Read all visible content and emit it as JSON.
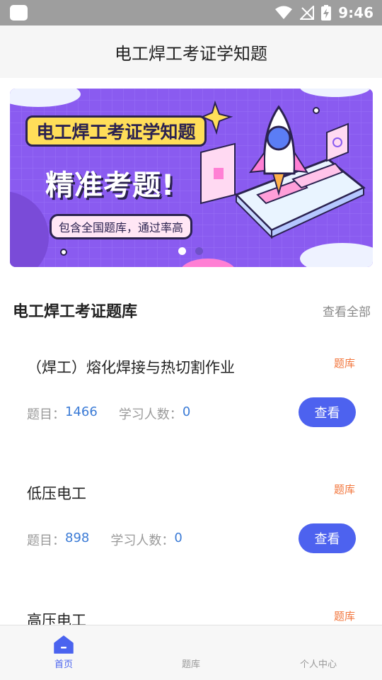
{
  "status_bar": {
    "time": "9:46"
  },
  "app_bar": {
    "title": "电工焊工考证学知题"
  },
  "banner": {
    "title": "电工焊工考证学知题",
    "headline": "精准考题!",
    "chip": "包含全国题库，通过率高",
    "pages": 2,
    "active_page": 1,
    "colors": {
      "background": "#8a5bf0",
      "title_bg": "#ffde59",
      "outline": "#2b2250"
    }
  },
  "section": {
    "title": "电工焊工考证题库",
    "more": "查看全部"
  },
  "cards": [
    {
      "name": "（焊工）熔化焊接与热切割作业",
      "tag": "题库",
      "questions_label": "题目：",
      "questions": "1466",
      "learners_label": "学习人数：",
      "learners": "0",
      "button": "查看"
    },
    {
      "name": "低压电工",
      "tag": "题库",
      "questions_label": "题目：",
      "questions": "898",
      "learners_label": "学习人数：",
      "learners": "0",
      "button": "查看"
    },
    {
      "name": "高压电工",
      "tag": "题库"
    }
  ],
  "bottom_nav": {
    "items": [
      {
        "label": "首页",
        "icon": "home-icon",
        "active": true
      },
      {
        "label": "题库",
        "icon": "question-bank-icon",
        "active": false
      },
      {
        "label": "个人中心",
        "icon": "profile-icon",
        "active": false
      }
    ]
  },
  "colors": {
    "accent": "#4d62ef",
    "tag": "#f2763d",
    "stat_number": "#3b7bd6"
  }
}
